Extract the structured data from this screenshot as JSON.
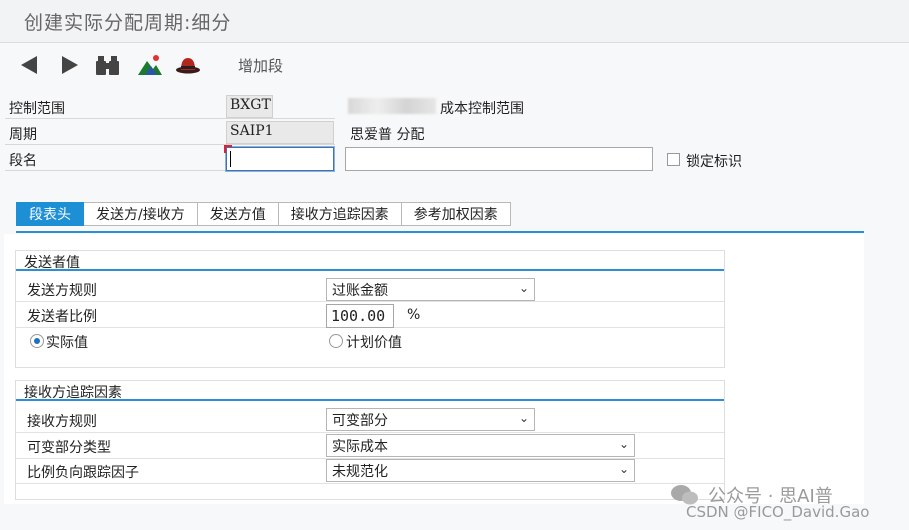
{
  "window": {
    "title": "创建实际分配周期:细分"
  },
  "toolbar": {
    "add_segment_label": "增加段"
  },
  "header": {
    "controlling_area": {
      "label": "控制范围",
      "value": "BXGT",
      "description": "成本控制范围"
    },
    "cycle": {
      "label": "周期",
      "value": "SAIP1",
      "description": "思爱普 分配"
    },
    "segment": {
      "label": "段名",
      "value": "",
      "text": "",
      "lock_label": "锁定标识"
    }
  },
  "tabs": [
    "段表头",
    "发送方/接收方",
    "发送方值",
    "接收方追踪因素",
    "参考加权因素"
  ],
  "active_tab": 0,
  "sender_values": {
    "title": "发送者值",
    "rule_label": "发送方规则",
    "rule_value": "过账金额",
    "share_label": "发送者比例",
    "share_value": "100.00",
    "share_unit": "%",
    "radio_actual": "实际值",
    "radio_plan": "计划价值"
  },
  "receiver_tracing": {
    "title": "接收方追踪因素",
    "rule_label": "接收方规则",
    "rule_value": "可变部分",
    "var_type_label": "可变部分类型",
    "var_type_value": "实际成本",
    "neg_track_label": "比例负向跟踪因子",
    "neg_track_value": "未规范化"
  },
  "watermark": {
    "line1": "公众号 · 思AI普",
    "line2": "CSDN @FICO_David.Gao"
  },
  "colors": {
    "accent": "#1d8fd4",
    "focus_corner": "#dd2233"
  }
}
